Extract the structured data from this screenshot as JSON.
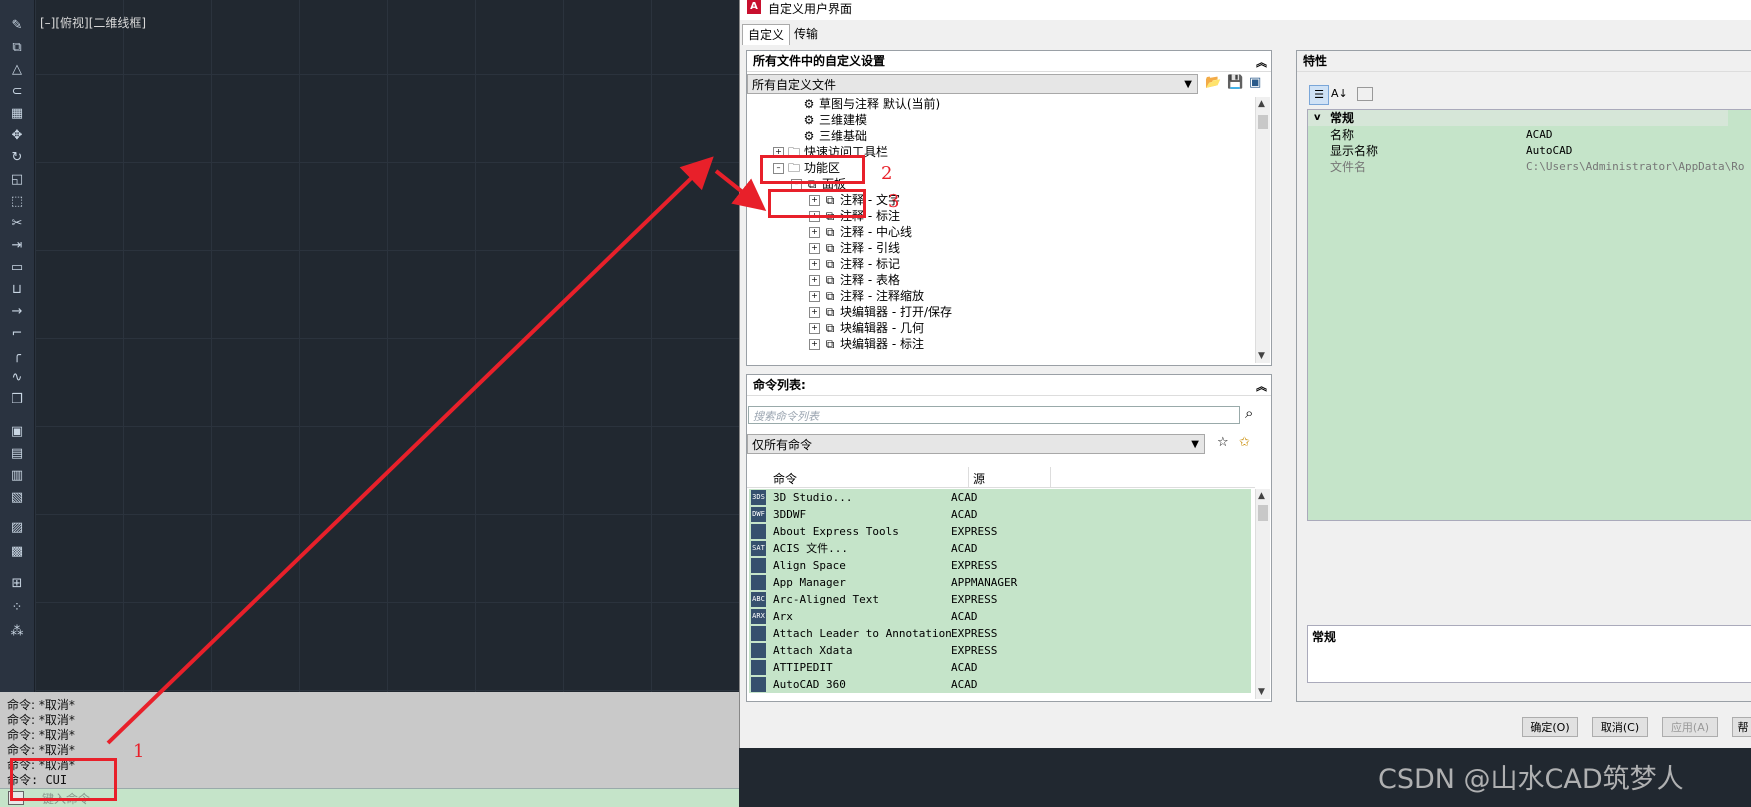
{
  "viewport": {
    "label": "[–][俯视][二维线框]"
  },
  "command_history": {
    "lines": [
      "命令: *取消*",
      "命令: *取消*",
      "命令: *取消*",
      "命令: *取消*",
      "命令: *取消*"
    ],
    "current": "命令: CUI",
    "input_placeholder": "键入命令"
  },
  "dialog": {
    "title": "自定义用户界面",
    "logo": "A",
    "tabs": [
      "自定义",
      "传输"
    ],
    "customizations_panel": {
      "header": "所有文件中的自定义设置",
      "file_select": "所有自定义文件",
      "tree": [
        {
          "label": "草图与注释 默认(当前)",
          "icon": "gear-icon"
        },
        {
          "label": "三维建模",
          "icon": "gear-icon"
        },
        {
          "label": "三维基础",
          "icon": "gear-icon"
        },
        {
          "label": "快速访问工具栏",
          "icon": "folder-icon"
        },
        {
          "label": "功能区",
          "icon": "folder-icon"
        },
        {
          "label": "面板",
          "icon": "panel-icon"
        },
        {
          "label": "注释 - 文字",
          "icon": "panel-icon"
        },
        {
          "label": "注释 - 标注",
          "icon": "panel-icon"
        },
        {
          "label": "注释 - 中心线",
          "icon": "panel-icon"
        },
        {
          "label": "注释 - 引线",
          "icon": "panel-icon"
        },
        {
          "label": "注释 - 标记",
          "icon": "panel-icon"
        },
        {
          "label": "注释 - 表格",
          "icon": "panel-icon"
        },
        {
          "label": "注释 - 注释缩放",
          "icon": "panel-icon"
        },
        {
          "label": "块编辑器 - 打开/保存",
          "icon": "panel-icon"
        },
        {
          "label": "块编辑器 - 几何",
          "icon": "panel-icon"
        },
        {
          "label": "块编辑器 - 标注",
          "icon": "panel-icon"
        }
      ]
    },
    "command_list_panel": {
      "header": "命令列表:",
      "search_placeholder": "搜索命令列表",
      "filter_select": "仅所有命令",
      "columns": [
        "命令",
        "源"
      ],
      "rows": [
        {
          "name": "3D Studio...",
          "source": "ACAD",
          "icon": "3DS"
        },
        {
          "name": "3DDWF",
          "source": "ACAD",
          "icon": "DWF"
        },
        {
          "name": "About Express Tools",
          "source": "EXPRESS",
          "icon": ""
        },
        {
          "name": "ACIS 文件...",
          "source": "ACAD",
          "icon": "SAT"
        },
        {
          "name": "Align Space",
          "source": "EXPRESS",
          "icon": ""
        },
        {
          "name": "App Manager",
          "source": "APPMANAGER",
          "icon": ""
        },
        {
          "name": "Arc-Aligned Text",
          "source": "EXPRESS",
          "icon": "ABC"
        },
        {
          "name": "Arx",
          "source": "ACAD",
          "icon": "ARX"
        },
        {
          "name": "Attach Leader to Annotation",
          "source": "EXPRESS",
          "icon": ""
        },
        {
          "name": "Attach Xdata",
          "source": "EXPRESS",
          "icon": ""
        },
        {
          "name": "ATTIPEDIT",
          "source": "ACAD",
          "icon": ""
        },
        {
          "name": "AutoCAD 360",
          "source": "ACAD",
          "icon": ""
        }
      ]
    },
    "properties_panel": {
      "header": "特性",
      "category": "常规",
      "rows": [
        {
          "name": "名称",
          "value": "ACAD"
        },
        {
          "name": "显示名称",
          "value": "AutoCAD"
        },
        {
          "name": "文件名",
          "value": "C:\\Users\\Administrator\\AppData\\Ro"
        }
      ],
      "description_title": "常规"
    },
    "buttons": {
      "ok": "确定(O)",
      "cancel": "取消(C)",
      "apply": "应用(A)",
      "help": "帮"
    }
  },
  "annotations": {
    "labels": [
      "1",
      "2",
      "3"
    ],
    "color": "#e8202a"
  },
  "watermark": "CSDN @山水CAD筑梦人"
}
